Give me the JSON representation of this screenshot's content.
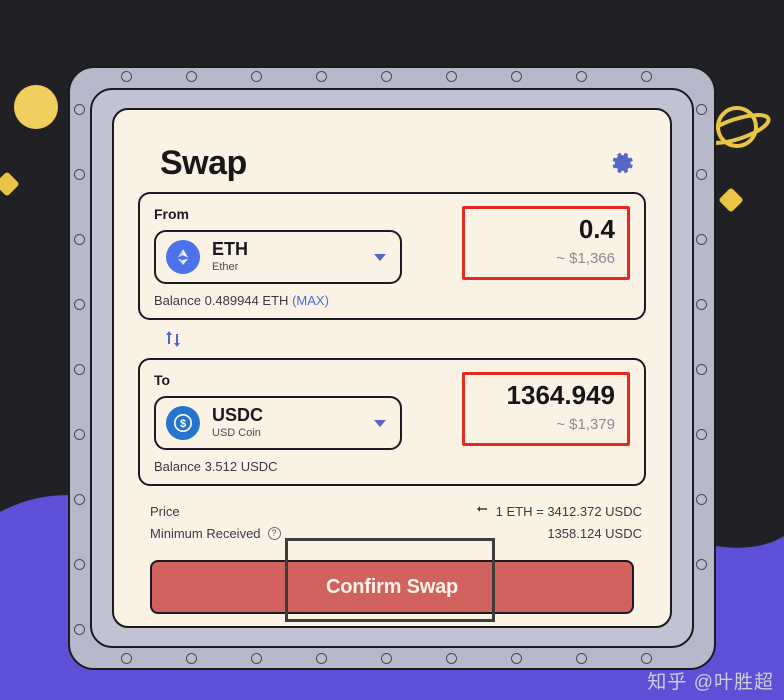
{
  "app": {
    "title": "Swap",
    "settings_icon": "gear-icon"
  },
  "from": {
    "label": "From",
    "token_symbol": "ETH",
    "token_name": "Ether",
    "token_icon": "ethereum-icon",
    "balance": "Balance 0.489944 ETH",
    "max_label": "(MAX)",
    "amount": "0.4",
    "amount_usd": "~ $1,366"
  },
  "switch": {
    "icon": "swap-direction-icon"
  },
  "to": {
    "label": "To",
    "token_symbol": "USDC",
    "token_name": "USD Coin",
    "token_icon": "usdc-icon",
    "balance": "Balance 3.512 USDC",
    "amount": "1364.949",
    "amount_usd": "~ $1,379"
  },
  "info": {
    "price_label": "Price",
    "price_value": "1 ETH = 3412.372 USDC",
    "price_toggle_icon": "swap-rate-icon",
    "minimum_label": "Minimum Received",
    "minimum_help_icon": "question-mark-icon",
    "minimum_value": "1358.124 USDC"
  },
  "confirm": {
    "label": "Confirm Swap"
  },
  "watermark": {
    "text": "知乎 @叶胜超"
  },
  "colors": {
    "background": "#212024",
    "wave": "#5b50d6",
    "frame": "#b7b9ca",
    "card": "#fbf2e6",
    "accent_blue": "#5566c4",
    "confirm_red": "#d1625f",
    "highlight_red": "#e8291f",
    "annotation_dark": "#3c3c38",
    "yellow": "#e8c544"
  },
  "decorations": {
    "planet": "saturn-icon",
    "circle": "yellow-circle",
    "diamonds": [
      "yellow-diamond",
      "yellow-diamond"
    ]
  }
}
